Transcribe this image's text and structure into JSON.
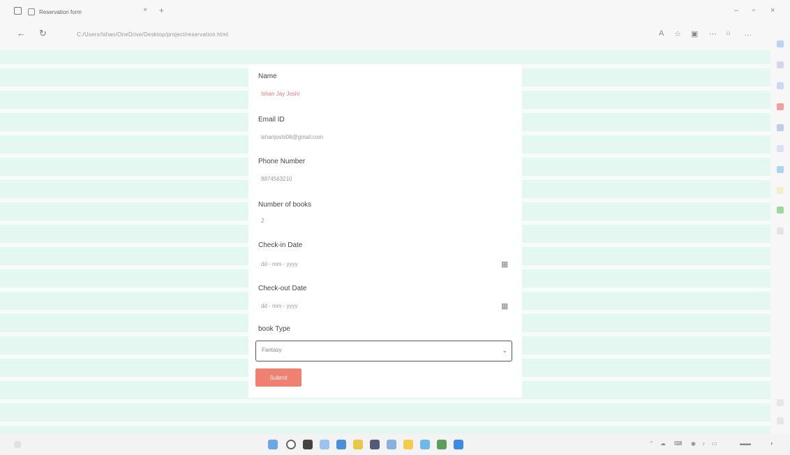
{
  "browser": {
    "tab_title": "Reservation form",
    "url": "C:/Users/Ishan/OneDrive/Desktop/project/reservation.html"
  },
  "form": {
    "fields": [
      {
        "label": "Name",
        "value": "Ishan Jay Joshi"
      },
      {
        "label": "Email ID",
        "value": "ishanjoshi08@gmail.com"
      },
      {
        "label": "Phone Number",
        "value": "9874563210"
      },
      {
        "label": "Number of books",
        "value": "2"
      },
      {
        "label": "Check-in Date",
        "value": "dd - mm - yyyy"
      },
      {
        "label": "Check-out Date",
        "value": "dd - mm - yyyy"
      }
    ],
    "book_type": {
      "label": "book Type",
      "selected": "Fantasy"
    },
    "submit_label": "Submit"
  },
  "colors": {
    "page_bg": "#e4f7f0",
    "submit": "#f08070",
    "value_red": "#dd7777"
  }
}
